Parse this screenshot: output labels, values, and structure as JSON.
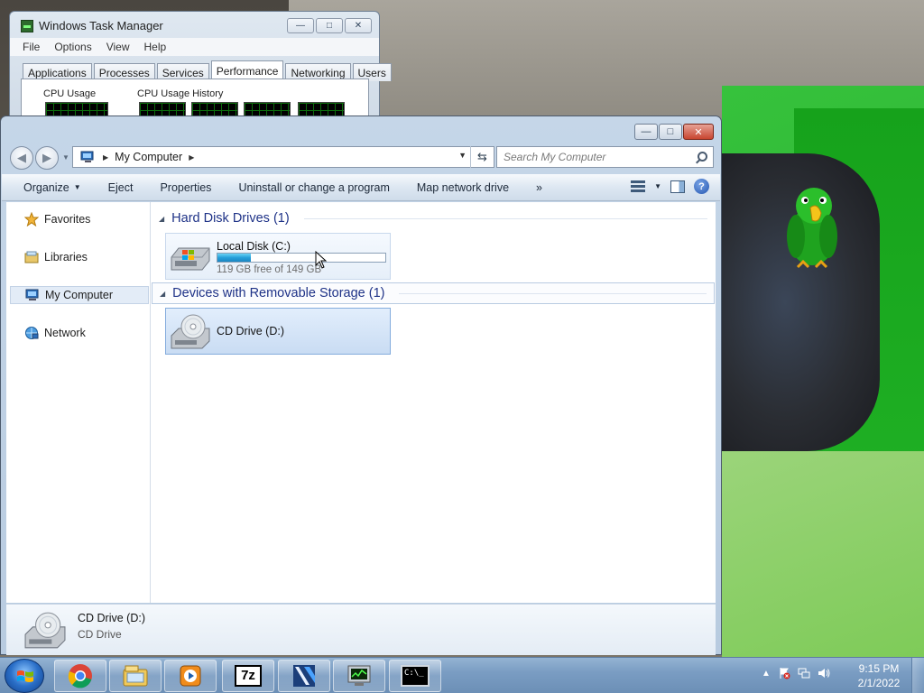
{
  "task_manager": {
    "title": "Windows Task Manager",
    "menu": [
      "File",
      "Options",
      "View",
      "Help"
    ],
    "tabs": [
      "Applications",
      "Processes",
      "Services",
      "Performance",
      "Networking",
      "Users"
    ],
    "active_tab": "Performance",
    "cpu_usage_label": "CPU Usage",
    "cpu_history_label": "CPU Usage History"
  },
  "explorer": {
    "breadcrumb": [
      "My Computer"
    ],
    "search_placeholder": "Search My Computer",
    "toolbar": {
      "organize": "Organize",
      "eject": "Eject",
      "properties": "Properties",
      "uninstall": "Uninstall or change a program",
      "map_drive": "Map network drive",
      "more": "»"
    },
    "sidebar": [
      {
        "label": "Favorites",
        "icon": "star-icon"
      },
      {
        "label": "Libraries",
        "icon": "libraries-icon"
      },
      {
        "label": "My Computer",
        "icon": "computer-icon",
        "selected": true
      },
      {
        "label": "Network",
        "icon": "network-icon"
      }
    ],
    "groups": [
      {
        "title": "Hard Disk Drives (1)",
        "items": [
          {
            "name": "Local Disk (C:)",
            "subtitle": "119 GB free of 149 GB",
            "used_fraction": 0.2
          }
        ]
      },
      {
        "title": "Devices with Removable Storage (1)",
        "items": [
          {
            "name": "CD Drive (D:)"
          }
        ]
      }
    ],
    "status": {
      "name": "CD Drive (D:)",
      "type": "CD Drive"
    }
  },
  "taskbar": {
    "clock_time": "9:15 PM",
    "clock_date": "2/1/2022",
    "apps": [
      "chrome-icon",
      "explorer-icon",
      "media-player-icon",
      "7zip-icon",
      "app-icon",
      "task-manager-icon",
      "cmd-icon"
    ],
    "seven_zip_label": "7z",
    "cmd_label": "C:\\_"
  },
  "colors": {
    "group_header": "#1e3287",
    "progress_fill": "#26a0da",
    "selection": "#c9dcf3"
  }
}
